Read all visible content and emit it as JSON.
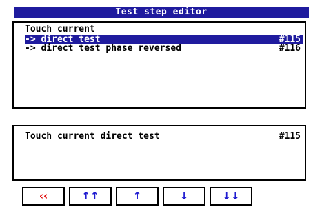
{
  "window": {
    "title": "Test step editor"
  },
  "list": {
    "heading": "Touch current",
    "items": [
      {
        "label": "-> direct test",
        "code": "#115",
        "selected": true
      },
      {
        "label": "-> direct test phase reversed",
        "code": "#116",
        "selected": false
      }
    ]
  },
  "detail": {
    "text": "Touch current direct test",
    "code": "#115"
  },
  "toolbar": {
    "buttons": [
      {
        "name": "back-button",
        "icon": "double-chevron-left-icon",
        "glyph": "‹‹",
        "color": "#e00000"
      },
      {
        "name": "first-button",
        "icon": "double-arrow-up-icon",
        "glyph": "↑↑",
        "color": "#1f1bd0"
      },
      {
        "name": "up-button",
        "icon": "arrow-up-icon",
        "glyph": "↑",
        "color": "#1f1bd0"
      },
      {
        "name": "down-button",
        "icon": "arrow-down-icon",
        "glyph": "↓",
        "color": "#1f1bd0"
      },
      {
        "name": "last-button",
        "icon": "double-arrow-down-icon",
        "glyph": "↓↓",
        "color": "#1f1bd0"
      }
    ]
  },
  "colors": {
    "title_bg": "#1f1b9e",
    "selection_bg": "#1f1b9e",
    "border": "#000000"
  }
}
